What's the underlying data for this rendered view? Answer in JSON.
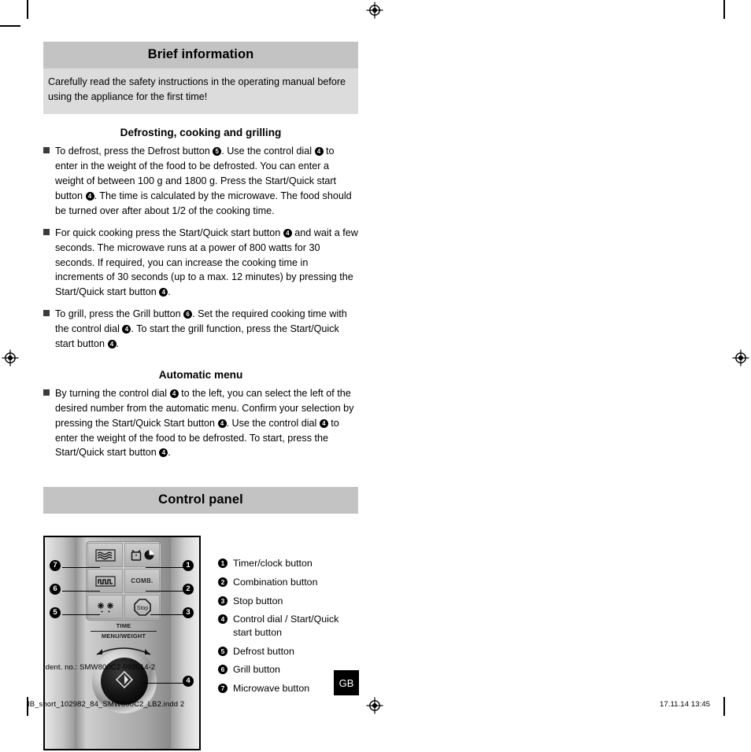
{
  "sections": {
    "brief": {
      "title": "Brief information",
      "body": "Carefully read the safety instructions in the operating manual before using the appliance for the first time!"
    },
    "control_panel": {
      "title": "Control panel"
    }
  },
  "subheadings": {
    "defrosting": "Defrosting, cooking and grilling",
    "automatic": "Automatic menu"
  },
  "bullets": {
    "defrost": {
      "p1": "To defrost, press the Defrost button ",
      "n1": "5",
      "p2": ". Use the control dial ",
      "n2": "4",
      "p3": " to enter in the weight of the food to be defrosted. You can enter a weight of between 100 g and 1800 g. Press the Start/Quick start button ",
      "n3": "4",
      "p4": ". The time is calculated by the microwave. The food should be turned over after about 1/2 of the cooking time."
    },
    "quick": {
      "p1": "For quick cooking press the Start/Quick start button ",
      "n1": "4",
      "p2": " and wait a few seconds. The microwave runs at a power of 800 watts for 30 seconds. If required, you can increase the cooking time in increments of 30 seconds (up to a max. 12 minutes) by pressing the Start/Quick start button ",
      "n2": "4",
      "p3": "."
    },
    "grill": {
      "p1": "To grill, press the Grill button ",
      "n1": "6",
      "p2": ". Set the required cooking time with the control dial ",
      "n2": "4",
      "p3": ". To start the grill function, press the Start/Quick start button ",
      "n3": "4",
      "p4": "."
    },
    "auto": {
      "p1": "By turning the control dial ",
      "n1": "4",
      "p2": " to the left, you can select the left of the desired number from the automatic menu. Confirm your selection by pressing the Start/Quick Start button ",
      "n2": "4",
      "p3": ". Use the control dial ",
      "n3": "4",
      "p4": " to enter the weight of the food to be defrosted. To start, press the Start/Quick start button ",
      "n4": "4",
      "p5": "."
    }
  },
  "legend": [
    {
      "num": "1",
      "label": "Timer/clock button"
    },
    {
      "num": "2",
      "label": "Combination button"
    },
    {
      "num": "3",
      "label": "Stop button"
    },
    {
      "num": "4",
      "label": "Control dial / Start/Quick start button"
    },
    {
      "num": "5",
      "label": "Defrost button"
    },
    {
      "num": "6",
      "label": "Grill button"
    },
    {
      "num": "7",
      "label": "Microwave button"
    }
  ],
  "figure": {
    "time_label": "TIME",
    "menu_weight_label": "MENU/WEIGHT",
    "comb_key_label": "COMB.",
    "stop_key_label": "Stop",
    "callouts": {
      "c1": "1",
      "c2": "2",
      "c3": "3",
      "c4": "4",
      "c5": "5",
      "c6": "6",
      "c7": "7"
    }
  },
  "footer": {
    "ident": "Ident. no.: SMW800C2-092014-2",
    "badge": "GB",
    "file": "IB_short_102982_84_SMW800C2_LB2.indd   2",
    "date": "17.11.14   13:45"
  },
  "colors": {
    "section_bar": "#c3c3c3",
    "section_body": "#dcdcdc",
    "bullet": "#3b3b3b",
    "text": "#000000"
  }
}
